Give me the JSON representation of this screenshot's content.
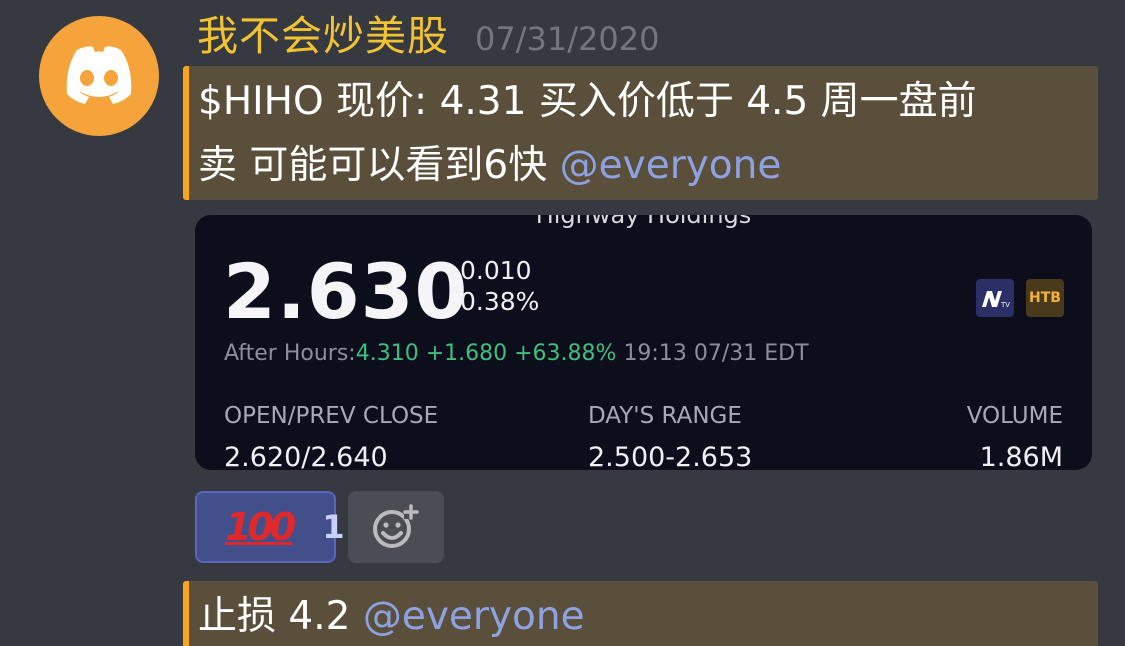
{
  "message": {
    "username": "我不会炒美股",
    "timestamp": "07/31/2020",
    "text_line1": "$HIHO 现价: 4.31 买入价低于 4.5 周一盘前",
    "text_line2": "卖 可能可以看到6快",
    "mention": "@everyone"
  },
  "quote_card": {
    "company": "Highway Holdings",
    "price": "2.630",
    "change": "-0.010",
    "change_percent": "-0.38%",
    "after_hours_label": "After Hours:",
    "after_hours_price": "4.310",
    "after_hours_change": "+1.680",
    "after_hours_percent": "+63.88%",
    "after_hours_time": "19:13 07/31 EDT",
    "badge_htb": "HTB",
    "badge_n_icon": "n-tv-logo-icon",
    "stats": {
      "open_prev_close_label": "OPEN/PREV CLOSE",
      "open_prev_close_value": "2.620/2.640",
      "days_range_label": "DAY'S RANGE",
      "days_range_value": "2.500-2.653",
      "volume_label": "VOLUME",
      "volume_value": "1.86M"
    }
  },
  "reactions": {
    "emoji_icon": "hundred-points-icon",
    "emoji": "💯",
    "count": "1",
    "add_icon": "add-reaction-icon"
  },
  "message2": {
    "text": "止损 4.2",
    "mention": "@everyone"
  },
  "colors": {
    "background": "#36393f",
    "username": "#f1c232",
    "mention_highlight": "#5a4f3b",
    "mention_bar": "#faa61a",
    "mention_text": "#8ea1e1",
    "avatar": "#f4a43a",
    "positive": "#3fbf7f"
  }
}
